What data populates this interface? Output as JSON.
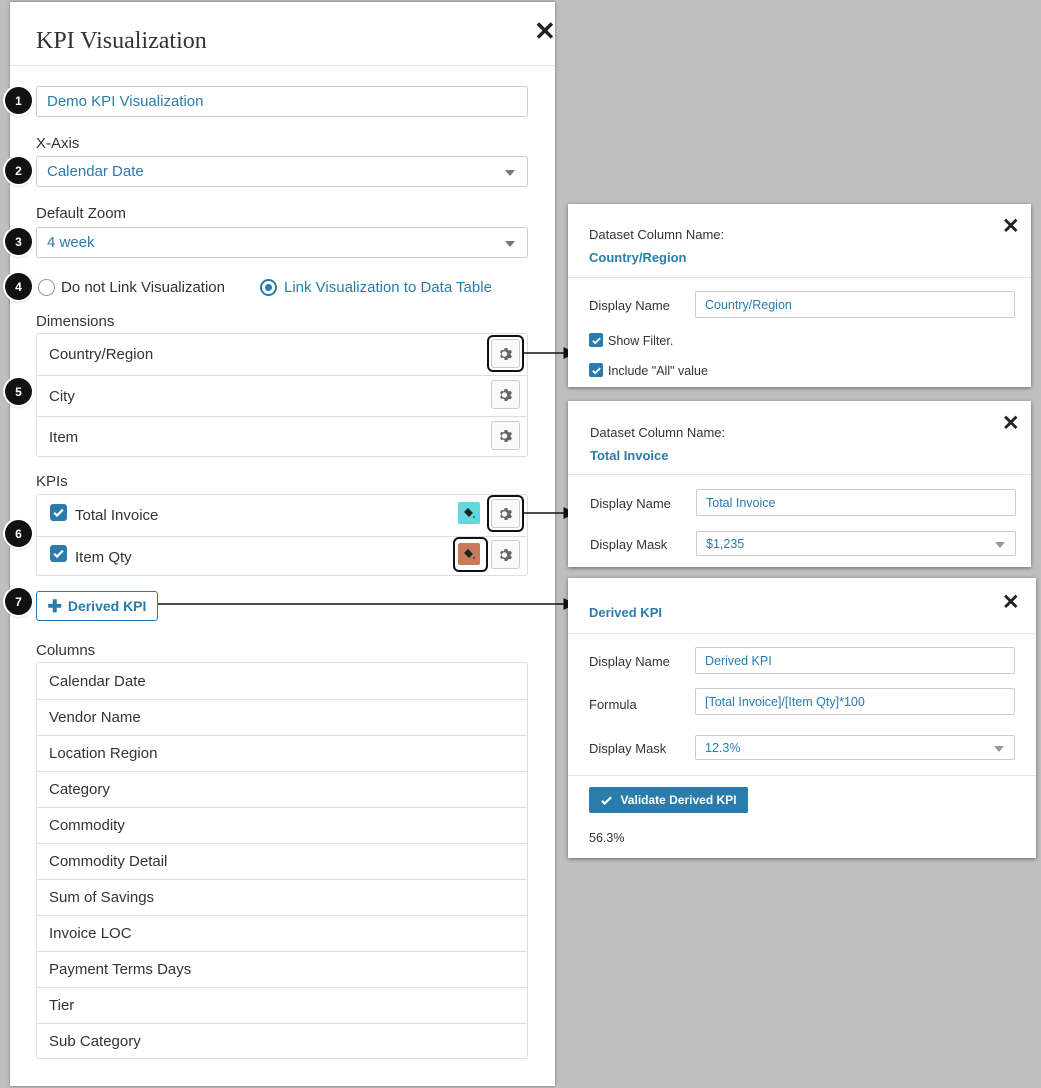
{
  "main": {
    "title": "KPI Visualization",
    "name_value": "Demo KPI Visualization",
    "x_axis_label": "X-Axis",
    "x_axis_value": "Calendar Date",
    "zoom_label": "Default Zoom",
    "zoom_value": "4 week",
    "link_options": [
      "Do not Link Visualization",
      "Link Visualization to Data Table"
    ],
    "link_selected": "Link Visualization to Data Table",
    "dimensions_label": "Dimensions",
    "dimensions": [
      "Country/Region",
      "City",
      "Item"
    ],
    "kpis_label": "KPIs",
    "kpis": [
      {
        "label": "Total Invoice",
        "color": "#5fd8e0"
      },
      {
        "label": "Item Qty",
        "color": "#c77a5c"
      }
    ],
    "derived_kpi_button": "Derived KPI",
    "columns_label": "Columns",
    "columns": [
      "Calendar Date",
      "Vendor Name",
      "Location Region",
      "Category",
      "Commodity",
      "Commodity Detail",
      "Sum of Savings",
      "Invoice LOC",
      "Payment Terms Days",
      "Tier",
      "Sub Category"
    ]
  },
  "steps": [
    "1",
    "2",
    "3",
    "4",
    "5",
    "6",
    "7"
  ],
  "popup_dimension": {
    "heading": "Dataset Column Name:",
    "column_name": "Country/Region",
    "display_name_label": "Display Name",
    "display_name_value": "Country/Region",
    "show_filter_label": "Show Filter.",
    "include_all_label": "Include \"All\" value"
  },
  "popup_kpi": {
    "heading": "Dataset Column Name:",
    "column_name": "Total Invoice",
    "display_name_label": "Display Name",
    "display_name_value": "Total Invoice",
    "display_mask_label": "Display Mask",
    "display_mask_value": "$1,235"
  },
  "popup_derived": {
    "title": "Derived KPI",
    "display_name_label": "Display Name",
    "display_name_value": "Derived KPI",
    "formula_label": "Formula",
    "formula_value": "[Total Invoice]/[Item Qty]*100",
    "display_mask_label": "Display Mask",
    "display_mask_value": "12.3%",
    "validate_button": "Validate Derived KPI",
    "result": "56.3%"
  },
  "colors": {
    "accent": "#2a7cac",
    "background": "#bfbfbf"
  }
}
